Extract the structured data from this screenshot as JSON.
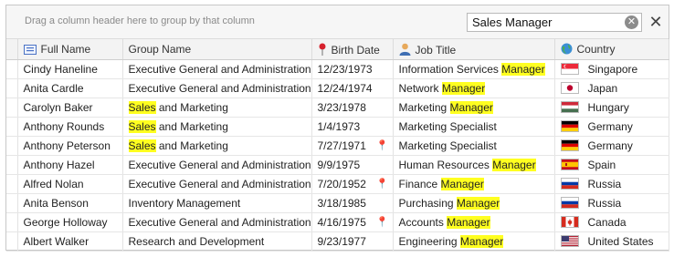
{
  "group_panel": {
    "hint": "Drag a column header here to group by that column"
  },
  "search": {
    "value": "Sales Manager"
  },
  "columns": [
    {
      "label": "Full Name",
      "icon": "card-icon"
    },
    {
      "label": "Group Name",
      "icon": ""
    },
    {
      "label": "Birth Date",
      "icon": "pin-icon"
    },
    {
      "label": "Job Title",
      "icon": "person-icon"
    },
    {
      "label": "Country",
      "icon": "globe-icon"
    }
  ],
  "rows": [
    {
      "name": "Cindy Haneline",
      "group": "Executive General and Administration",
      "group_hl": "",
      "birth": "12/23/1973",
      "pin": false,
      "job_pre": "Information Services ",
      "job_hl": "Manager",
      "job_post": "",
      "country": "Singapore",
      "flag": "singapore"
    },
    {
      "name": "Anita Cardle",
      "group": "Executive General and Administration",
      "group_hl": "",
      "birth": "12/24/1974",
      "pin": false,
      "job_pre": "Network ",
      "job_hl": "Manager",
      "job_post": "",
      "country": "Japan",
      "flag": "japan"
    },
    {
      "name": "Carolyn Baker",
      "group": " and Marketing",
      "group_hl": "Sales",
      "birth": "3/23/1978",
      "pin": false,
      "job_pre": "Marketing ",
      "job_hl": "Manager",
      "job_post": "",
      "country": "Hungary",
      "flag": "hungary"
    },
    {
      "name": "Anthony Rounds",
      "group": " and Marketing",
      "group_hl": "Sales",
      "birth": "1/4/1973",
      "pin": false,
      "job_pre": "Marketing Specialist",
      "job_hl": "",
      "job_post": "",
      "country": "Germany",
      "flag": "germany"
    },
    {
      "name": "Anthony Peterson",
      "group": " and Marketing",
      "group_hl": "Sales",
      "birth": "7/27/1971",
      "pin": true,
      "job_pre": "Marketing Specialist",
      "job_hl": "",
      "job_post": "",
      "country": "Germany",
      "flag": "germany"
    },
    {
      "name": "Anthony Hazel",
      "group": "Executive General and Administration",
      "group_hl": "",
      "birth": "9/9/1975",
      "pin": false,
      "job_pre": "Human Resources ",
      "job_hl": "Manager",
      "job_post": "",
      "country": "Spain",
      "flag": "spain"
    },
    {
      "name": "Alfred Nolan",
      "group": "Executive General and Administration",
      "group_hl": "",
      "birth": "7/20/1952",
      "pin": true,
      "job_pre": "Finance ",
      "job_hl": "Manager",
      "job_post": "",
      "country": "Russia",
      "flag": "russia"
    },
    {
      "name": "Anita Benson",
      "group": "Inventory Management",
      "group_hl": "",
      "birth": "3/18/1985",
      "pin": false,
      "job_pre": "Purchasing ",
      "job_hl": "Manager",
      "job_post": "",
      "country": "Russia",
      "flag": "russia"
    },
    {
      "name": "George Holloway",
      "group": "Executive General and Administration",
      "group_hl": "",
      "birth": "4/16/1975",
      "pin": true,
      "job_pre": "Accounts ",
      "job_hl": "Manager",
      "job_post": "",
      "country": "Canada",
      "flag": "canada"
    },
    {
      "name": "Albert Walker",
      "group": "Research and Development",
      "group_hl": "",
      "birth": "9/23/1977",
      "pin": false,
      "job_pre": "Engineering ",
      "job_hl": "Manager",
      "job_post": "",
      "country": "United States",
      "flag": "usa"
    }
  ],
  "colors": {
    "highlight": "#ffff20",
    "pin": "#d6202c"
  }
}
